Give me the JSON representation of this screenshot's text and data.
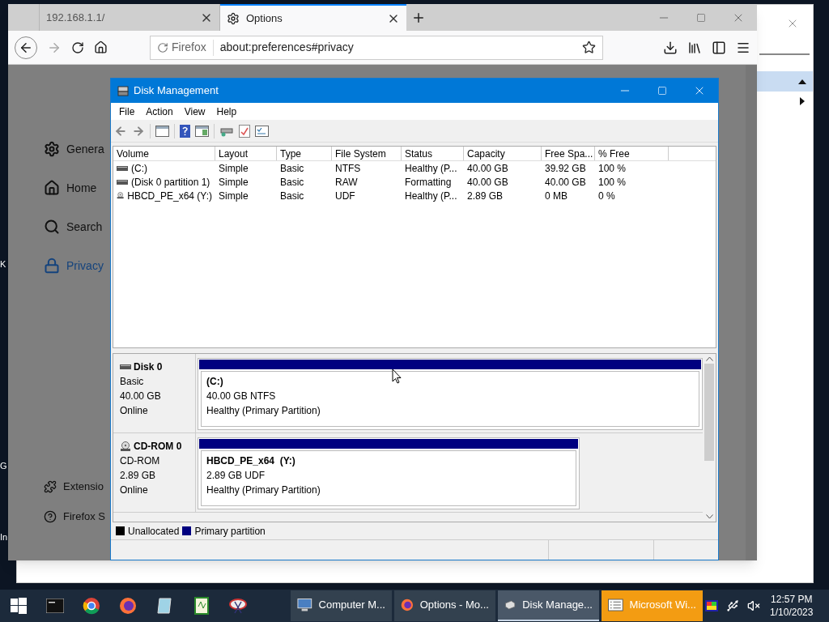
{
  "desktop": {
    "icon_labels": [
      "K",
      "G",
      "In"
    ]
  },
  "browser": {
    "tabs": [
      {
        "title": "192.168.1.1/",
        "selected": false
      },
      {
        "title": "Options",
        "selected": true
      }
    ],
    "identity": "Firefox",
    "url": "about:preferences#privacy",
    "sidebar": [
      {
        "label": "Genera",
        "selected": false
      },
      {
        "label": "Home",
        "selected": false
      },
      {
        "label": "Search",
        "selected": false
      },
      {
        "label": "Privacy",
        "selected": true
      }
    ],
    "footer_links": [
      "Extensio",
      "Firefox S"
    ]
  },
  "disk_management": {
    "title": "Disk Management",
    "menu": [
      "File",
      "Action",
      "View",
      "Help"
    ],
    "columns": [
      "Volume",
      "Layout",
      "Type",
      "File System",
      "Status",
      "Capacity",
      "Free Spa...",
      "% Free"
    ],
    "rows": [
      {
        "kind": "disk",
        "cells": [
          " (C:)",
          "Simple",
          "Basic",
          "NTFS",
          "Healthy (P...",
          "40.00 GB",
          "39.92 GB",
          "100 %"
        ]
      },
      {
        "kind": "disk",
        "cells": [
          "(Disk 0 partition 1)",
          "Simple",
          "Basic",
          "RAW",
          "Formatting",
          "40.00 GB",
          "40.00 GB",
          "100 %"
        ]
      },
      {
        "kind": "cdrom",
        "cells": [
          "HBCD_PE_x64 (Y:)",
          "Simple",
          "Basic",
          "UDF",
          "Healthy (P...",
          "2.89 GB",
          "0 MB",
          "0 %"
        ]
      }
    ],
    "disks": [
      {
        "kind": "disk",
        "name": "Disk 0",
        "type": "Basic",
        "size": "40.00 GB",
        "status": "Online",
        "partition": {
          "name": "(C:)",
          "detail": "40.00 GB NTFS",
          "status": "Healthy (Primary Partition)",
          "color": "#000080"
        }
      },
      {
        "kind": "cdrom",
        "name": "CD-ROM 0",
        "type": "CD-ROM",
        "size": "2.89 GB",
        "status": "Online",
        "partition": {
          "name": "HBCD_PE_x64  (Y:)",
          "detail": "2.89 GB UDF",
          "status": "Healthy (Primary Partition)",
          "color": "#000080"
        }
      }
    ],
    "legend": [
      {
        "label": "Unallocated",
        "color": "#000000"
      },
      {
        "label": "Primary partition",
        "color": "#000080"
      }
    ]
  },
  "taskbar": {
    "tasks": [
      {
        "label": "Computer M...",
        "selected": false,
        "attention": false
      },
      {
        "label": "Options - Mo...",
        "selected": false,
        "attention": false
      },
      {
        "label": "Disk Manage...",
        "selected": true,
        "attention": false
      },
      {
        "label": "Microsoft Wi...",
        "selected": false,
        "attention": true
      }
    ],
    "time": "12:57 PM",
    "date": "1/10/2023"
  }
}
